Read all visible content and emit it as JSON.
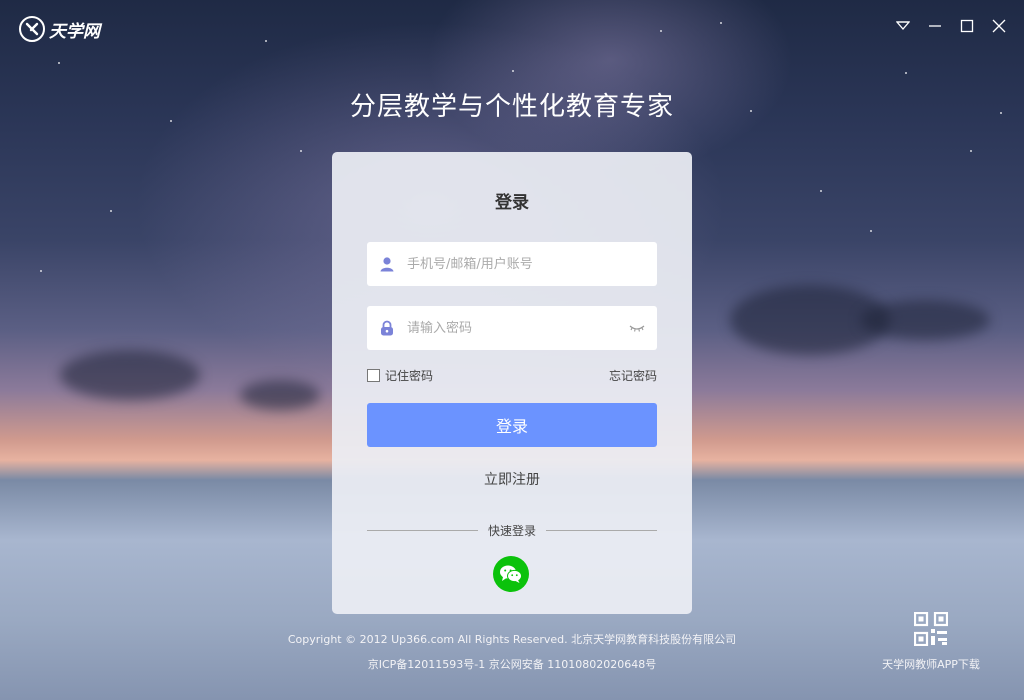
{
  "app": {
    "logo_text": "天学网"
  },
  "headline": "分层教学与个性化教育专家",
  "login": {
    "title": "登录",
    "username_placeholder": "手机号/邮箱/用户账号",
    "password_placeholder": "请输入密码",
    "remember_label": "记住密码",
    "forgot_label": "忘记密码",
    "login_button": "登录",
    "register_label": "立即注册",
    "quick_login_label": "快速登录"
  },
  "footer": {
    "copyright": "Copyright © 2012 Up366.com All Rights Reserved. 北京天学网教育科技股份有限公司",
    "icp": "京ICP备12011593号-1 京公网安备 11010802020648号"
  },
  "app_download": {
    "label": "天学网教师APP下载"
  },
  "colors": {
    "accent": "#6b93ff",
    "wechat": "#0bc20b",
    "icon_purple": "#7b83d8"
  },
  "icons": [
    "logo-icon",
    "dropdown-icon",
    "minimize-icon",
    "maximize-icon",
    "close-icon",
    "user-icon",
    "lock-icon",
    "eye-closed-icon",
    "wechat-icon",
    "qr-code-icon"
  ]
}
